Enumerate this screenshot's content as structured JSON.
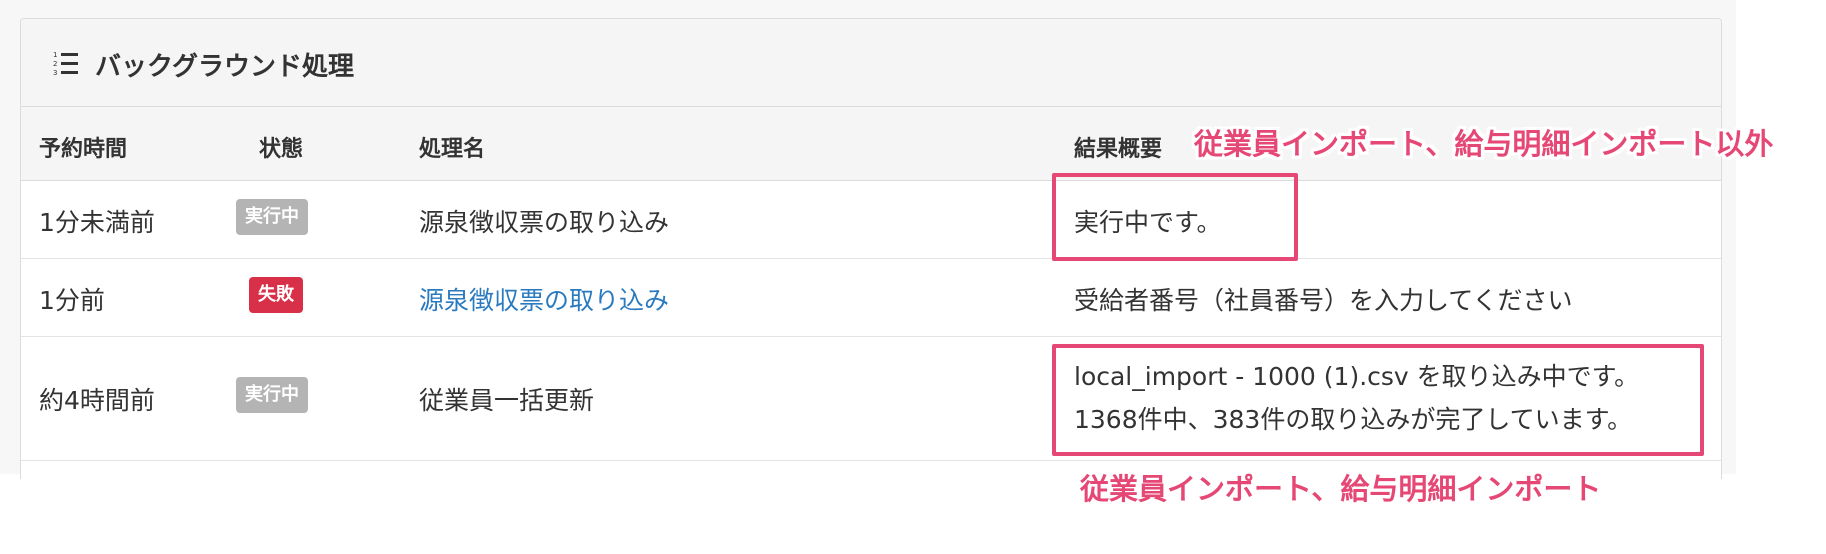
{
  "panel": {
    "title": "バックグラウンド処理",
    "icon": "ordered-list-icon"
  },
  "table": {
    "headers": {
      "scheduled": "予約時間",
      "status": "状態",
      "name": "処理名",
      "result": "結果概要"
    },
    "rows": [
      {
        "scheduled": "1分未満前",
        "status": "実行中",
        "status_color": "#b4b4b4",
        "name": "源泉徴収票の取り込み",
        "name_is_link": false,
        "result_line1": "実行中です。",
        "result_line2": ""
      },
      {
        "scheduled": "1分前",
        "status": "失敗",
        "status_color": "#d9304a",
        "name": "源泉徴収票の取り込み",
        "name_is_link": true,
        "result_line1": "受給者番号（社員番号）を入力してください",
        "result_line2": ""
      },
      {
        "scheduled": "約4時間前",
        "status": "実行中",
        "status_color": "#b4b4b4",
        "name": "従業員一括更新",
        "name_is_link": false,
        "result_line1": "local_import - 1000 (1).csv を取り込み中です。",
        "result_line2": "1368件中、383件の取り込みが完了しています。"
      }
    ]
  },
  "annotations": {
    "top": "従業員インポート、給与明細インポート以外",
    "bottom": "従業員インポート、給与明細インポート"
  },
  "colors": {
    "annotation": "#e64876",
    "link": "#2a7ac0",
    "header_bg": "#f5f5f5"
  }
}
